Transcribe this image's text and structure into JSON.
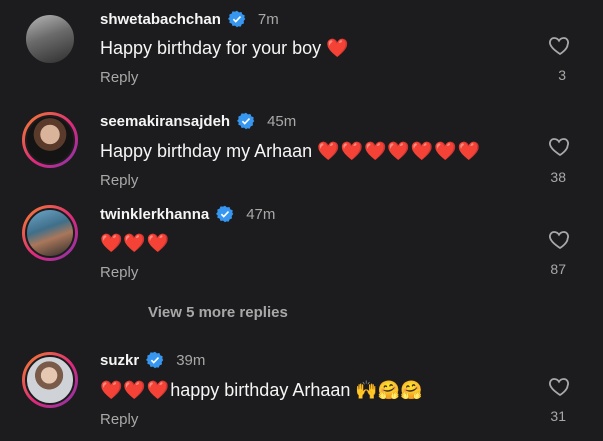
{
  "comments": [
    {
      "username": "shwetabachchan",
      "time": "7m",
      "text": "Happy birthday for your boy",
      "hearts": "❤️",
      "emojis": "",
      "reply": "Reply",
      "likes": "3",
      "story_ring": false
    },
    {
      "username": "seemakiransajdeh",
      "time": "45m",
      "text": "Happy birthday my Arhaan",
      "hearts": "❤️❤️❤️❤️❤️❤️❤️",
      "emojis": "",
      "reply": "Reply",
      "likes": "38",
      "story_ring": true
    },
    {
      "username": "twinklerkhanna",
      "time": "47m",
      "text": "",
      "hearts": "❤️❤️❤️",
      "emojis": "",
      "reply": "Reply",
      "likes": "87",
      "story_ring": true
    },
    {
      "username": "suzkr",
      "time": "39m",
      "text": "happy birthday Arhaan",
      "hearts": "❤️❤️❤️",
      "emojis": "🙌🤗🤗",
      "reply": "Reply",
      "likes": "31",
      "story_ring": true
    }
  ],
  "view_more_replies": "View 5 more replies",
  "colors": {
    "background": "#1c1c1e",
    "verified": "#3797f0",
    "heart": "#ed2939",
    "muted": "#a8a8a8"
  },
  "icons": {
    "verified": "verified-badge-icon",
    "like": "heart-outline-icon"
  }
}
